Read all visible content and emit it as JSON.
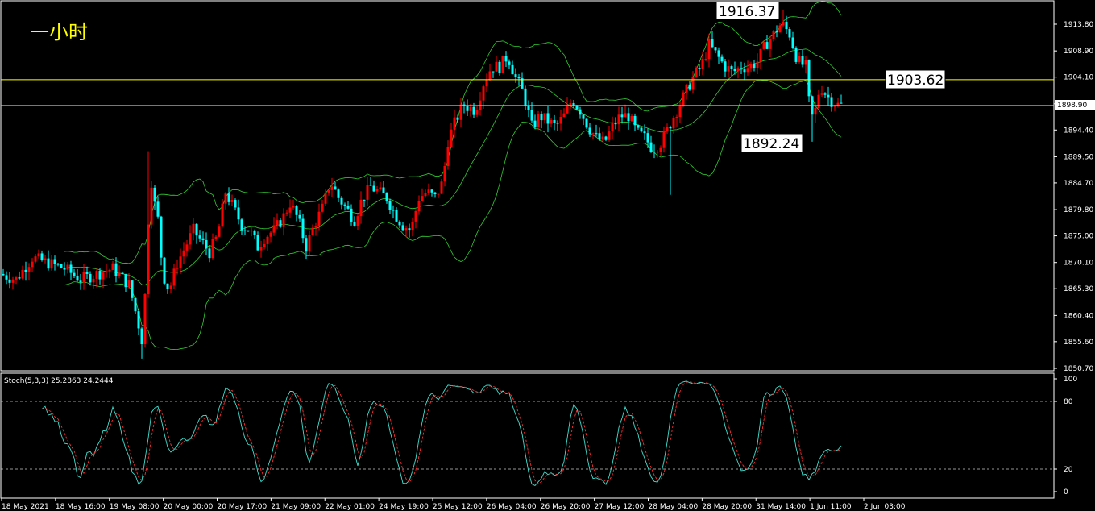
{
  "timeframe_label": "一小时",
  "indicator_label": "Stoch(5,3,3) 25.2863 24.2444",
  "annotations": {
    "high_label": "1916.37",
    "low_label": "1892.24",
    "level_label": "1903.62",
    "current_price_label": "1898.90"
  },
  "colors": {
    "background": "#000000",
    "bull": "#ff0000",
    "bear": "#00ffff",
    "band": "#32cd32",
    "stoch_main": "#40e0d0",
    "stoch_signal": "#ff3030",
    "level_line": "#ffff00",
    "current_line": "#b0c4de",
    "grid_dotted": "#c8c8c8",
    "title": "#ffff00"
  },
  "chart_data": [
    {
      "type": "candlestick",
      "title": "",
      "y_ticks": [
        "1913.80",
        "1908.90",
        "1904.10",
        "1899.20",
        "1894.40",
        "1889.50",
        "1884.70",
        "1879.80",
        "1875.00",
        "1870.10",
        "1865.30",
        "1860.40",
        "1855.60",
        "1850.70"
      ],
      "ylim": [
        1850.7,
        1916.37
      ],
      "x_ticks": [
        "18 May 2021",
        "18 May 16:00",
        "19 May 08:00",
        "20 May 00:00",
        "20 May 17:00",
        "21 May 09:00",
        "22 May 01:00",
        "24 May 19:00",
        "25 May 12:00",
        "26 May 04:00",
        "26 May 20:00",
        "27 May 12:00",
        "28 May 04:00",
        "28 May 20:00",
        "31 May 14:00",
        "1 Jun 11:00",
        "2 Jun 03:00"
      ],
      "horizontal_levels": [
        1903.62,
        1898.9
      ],
      "labeled_high": 1916.37,
      "labeled_low": 1892.24,
      "overlays": [
        "bollinger_upper",
        "bollinger_middle",
        "bollinger_lower"
      ],
      "close_path": [
        [
          0,
          1868
        ],
        [
          20,
          1867
        ],
        [
          40,
          1871
        ],
        [
          60,
          1870
        ],
        [
          80,
          1869
        ],
        [
          100,
          1867
        ],
        [
          120,
          1868
        ],
        [
          140,
          1869
        ],
        [
          160,
          1866
        ],
        [
          170,
          1860
        ],
        [
          176,
          1856
        ],
        [
          182,
          1868
        ],
        [
          186,
          1888
        ],
        [
          190,
          1882
        ],
        [
          196,
          1878
        ],
        [
          202,
          1868
        ],
        [
          210,
          1865
        ],
        [
          220,
          1870
        ],
        [
          230,
          1873
        ],
        [
          240,
          1876
        ],
        [
          250,
          1874
        ],
        [
          260,
          1872
        ],
        [
          270,
          1875
        ],
        [
          280,
          1883
        ],
        [
          290,
          1880
        ],
        [
          300,
          1877
        ],
        [
          310,
          1876
        ],
        [
          320,
          1873
        ],
        [
          330,
          1875
        ],
        [
          340,
          1876
        ],
        [
          350,
          1878
        ],
        [
          360,
          1881
        ],
        [
          370,
          1878
        ],
        [
          380,
          1873
        ],
        [
          390,
          1877
        ],
        [
          400,
          1880
        ],
        [
          410,
          1885
        ],
        [
          420,
          1882
        ],
        [
          430,
          1880
        ],
        [
          440,
          1878
        ],
        [
          450,
          1882
        ],
        [
          460,
          1884
        ],
        [
          470,
          1883
        ],
        [
          480,
          1882
        ],
        [
          490,
          1879
        ],
        [
          500,
          1877
        ],
        [
          510,
          1876
        ],
        [
          520,
          1882
        ],
        [
          530,
          1883
        ],
        [
          540,
          1882
        ],
        [
          550,
          1885
        ],
        [
          555,
          1892
        ],
        [
          565,
          1896
        ],
        [
          575,
          1899
        ],
        [
          590,
          1898
        ],
        [
          600,
          1903
        ],
        [
          610,
          1906
        ],
        [
          620,
          1906
        ],
        [
          630,
          1908
        ],
        [
          640,
          1904
        ],
        [
          650,
          1901
        ],
        [
          660,
          1895
        ],
        [
          670,
          1897
        ],
        [
          680,
          1896
        ],
        [
          690,
          1895
        ],
        [
          700,
          1897
        ],
        [
          710,
          1900
        ],
        [
          720,
          1898
        ],
        [
          730,
          1895
        ],
        [
          740,
          1893
        ],
        [
          750,
          1892
        ],
        [
          760,
          1895
        ],
        [
          770,
          1897
        ],
        [
          780,
          1897
        ],
        [
          790,
          1894
        ],
        [
          800,
          1893
        ],
        [
          810,
          1891
        ],
        [
          820,
          1892
        ],
        [
          830,
          1895
        ],
        [
          840,
          1898
        ],
        [
          850,
          1901
        ],
        [
          860,
          1904
        ],
        [
          870,
          1906
        ],
        [
          880,
          1910
        ],
        [
          890,
          1908
        ],
        [
          900,
          1906
        ],
        [
          910,
          1905
        ],
        [
          920,
          1906
        ],
        [
          930,
          1906
        ],
        [
          940,
          1907
        ],
        [
          950,
          1910
        ],
        [
          960,
          1912
        ],
        [
          970,
          1914
        ],
        [
          980,
          1912
        ],
        [
          990,
          1907
        ],
        [
          1000,
          1906
        ],
        [
          1005,
          1898
        ],
        [
          1010,
          1896
        ],
        [
          1015,
          1901
        ],
        [
          1020,
          1902
        ],
        [
          1030,
          1900
        ],
        [
          1040,
          1899
        ],
        [
          1045,
          1899
        ]
      ]
    },
    {
      "type": "line",
      "title": "Stoch(5,3,3)",
      "y_ticks": [
        "100",
        "80",
        "20",
        "0"
      ],
      "ylim": [
        0,
        100
      ],
      "levels": [
        80,
        20
      ],
      "last_values": [
        25.2863,
        24.2444
      ]
    }
  ]
}
